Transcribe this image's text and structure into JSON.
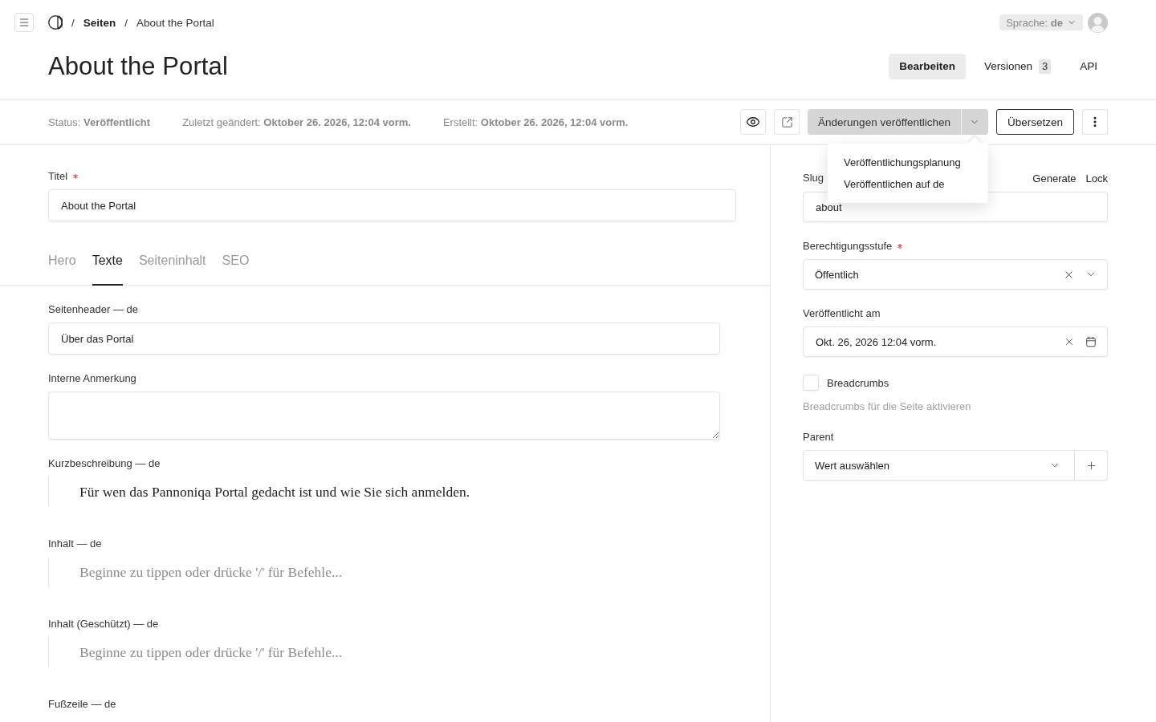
{
  "topbar": {
    "separator": "/",
    "breadcrumbs": [
      {
        "label": "Seiten",
        "current": false
      },
      {
        "label": "About the Portal",
        "current": true
      }
    ],
    "language": "Sprache: **de**"
  },
  "header": {
    "title": "About the Portal",
    "tabs": [
      {
        "label": "Bearbeiten",
        "selected": true
      },
      {
        "label": "Versionen",
        "count": "3",
        "selected": false
      },
      {
        "label": "API",
        "selected": false
      }
    ]
  },
  "meta": [
    "Status: **Veröffentlicht**",
    "Zuletzt geändert: **Oktober 26. 2026, 12:04 vorm.**",
    "Erstellt: **Oktober 26. 2026, 12:04 vorm.**"
  ],
  "actions": {
    "publish": "Änderungen veröffentlichen",
    "translate": "Übersetzen",
    "publish_menu": {
      "open": true,
      "items": [
        "Veröffentlichungsplanung",
        "Veröffentlichen auf de"
      ]
    }
  },
  "main": {
    "title_field": {
      "label": "Titel",
      "required": true,
      "value": "About the Portal"
    },
    "tabs": [
      {
        "label": "Hero",
        "selected": false
      },
      {
        "label": "Texte",
        "selected": true
      },
      {
        "label": "Seiteninhalt",
        "selected": false
      },
      {
        "label": "SEO",
        "selected": false
      }
    ],
    "fields": [
      {
        "kind": "text",
        "label": "Seitenheader — de",
        "required": false,
        "value": "Über das Portal"
      },
      {
        "kind": "textarea",
        "label": "Interne Anmerkung",
        "required": false
      },
      {
        "kind": "editor",
        "label": "Kurzbeschreibung — de",
        "required": false,
        "value": "Für wen das Pannoniqa Portal gedacht ist und wie Sie sich anmelden."
      },
      {
        "kind": "editor",
        "label": "Inhalt — de",
        "required": false,
        "placeholder": "Beginne zu tippen oder drücke '/' für Befehle..."
      },
      {
        "kind": "editor",
        "label": "Inhalt (Geschützt) — de",
        "required": false,
        "placeholder": "Beginne zu tippen oder drücke '/' für Befehle..."
      },
      {
        "kind": "editor",
        "label": "Fußzeile — de",
        "required": false
      }
    ]
  },
  "sidebar": {
    "fields": [
      {
        "kind": "slug",
        "label": "Slug",
        "required": false,
        "value": "about",
        "actions": [
          "Generate",
          "Lock"
        ]
      },
      {
        "kind": "select",
        "label": "Berechtigungsstufe",
        "required": true,
        "value": "Öffentlich"
      },
      {
        "kind": "date",
        "label": "Veröffentlicht am",
        "required": false,
        "value": "Okt. 26, 2026 12:04 vorm."
      },
      {
        "kind": "checkbox",
        "label": "Breadcrumbs",
        "checked": false,
        "description": "Breadcrumbs für die Seite aktivieren"
      },
      {
        "kind": "relation",
        "label": "Parent",
        "required": false,
        "placeholder": "Wert auswählen"
      }
    ]
  }
}
